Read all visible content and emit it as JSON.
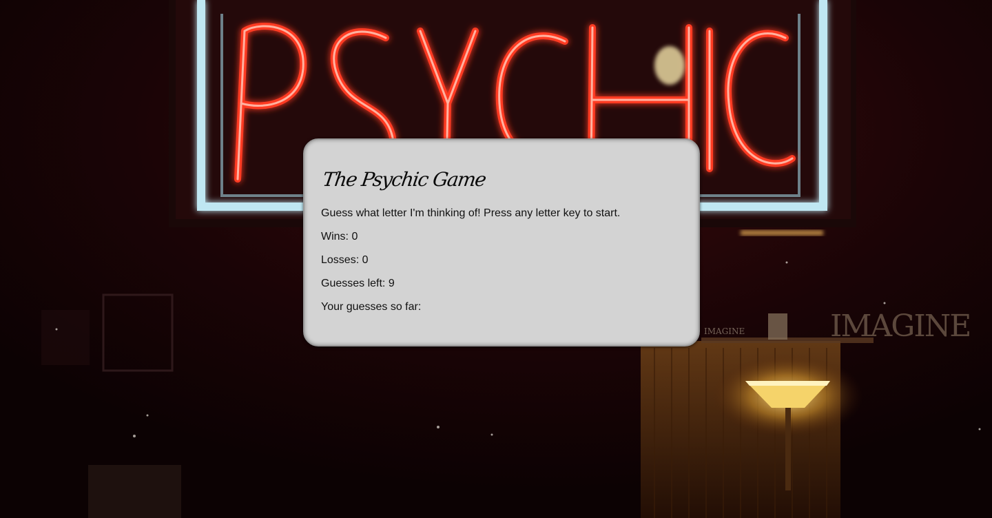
{
  "background": {
    "sign_text": "PSYCHIC",
    "shop_sign_text": "IMAGINE",
    "small_sign_text": "IMAGINE",
    "neon_color": "#ff2a1a",
    "frame_color": "#bfe7f2"
  },
  "game": {
    "title": "The Psychic Game",
    "instructions": "Guess what letter I'm thinking of! Press any letter key to start.",
    "wins_label": "Wins: ",
    "wins": "0",
    "losses_label": "Losses: ",
    "losses": "0",
    "guesses_left_label": "Guesses left: ",
    "guesses_left": "9",
    "guesses_so_far_label": "Your guesses so far: ",
    "guesses_so_far": ""
  }
}
